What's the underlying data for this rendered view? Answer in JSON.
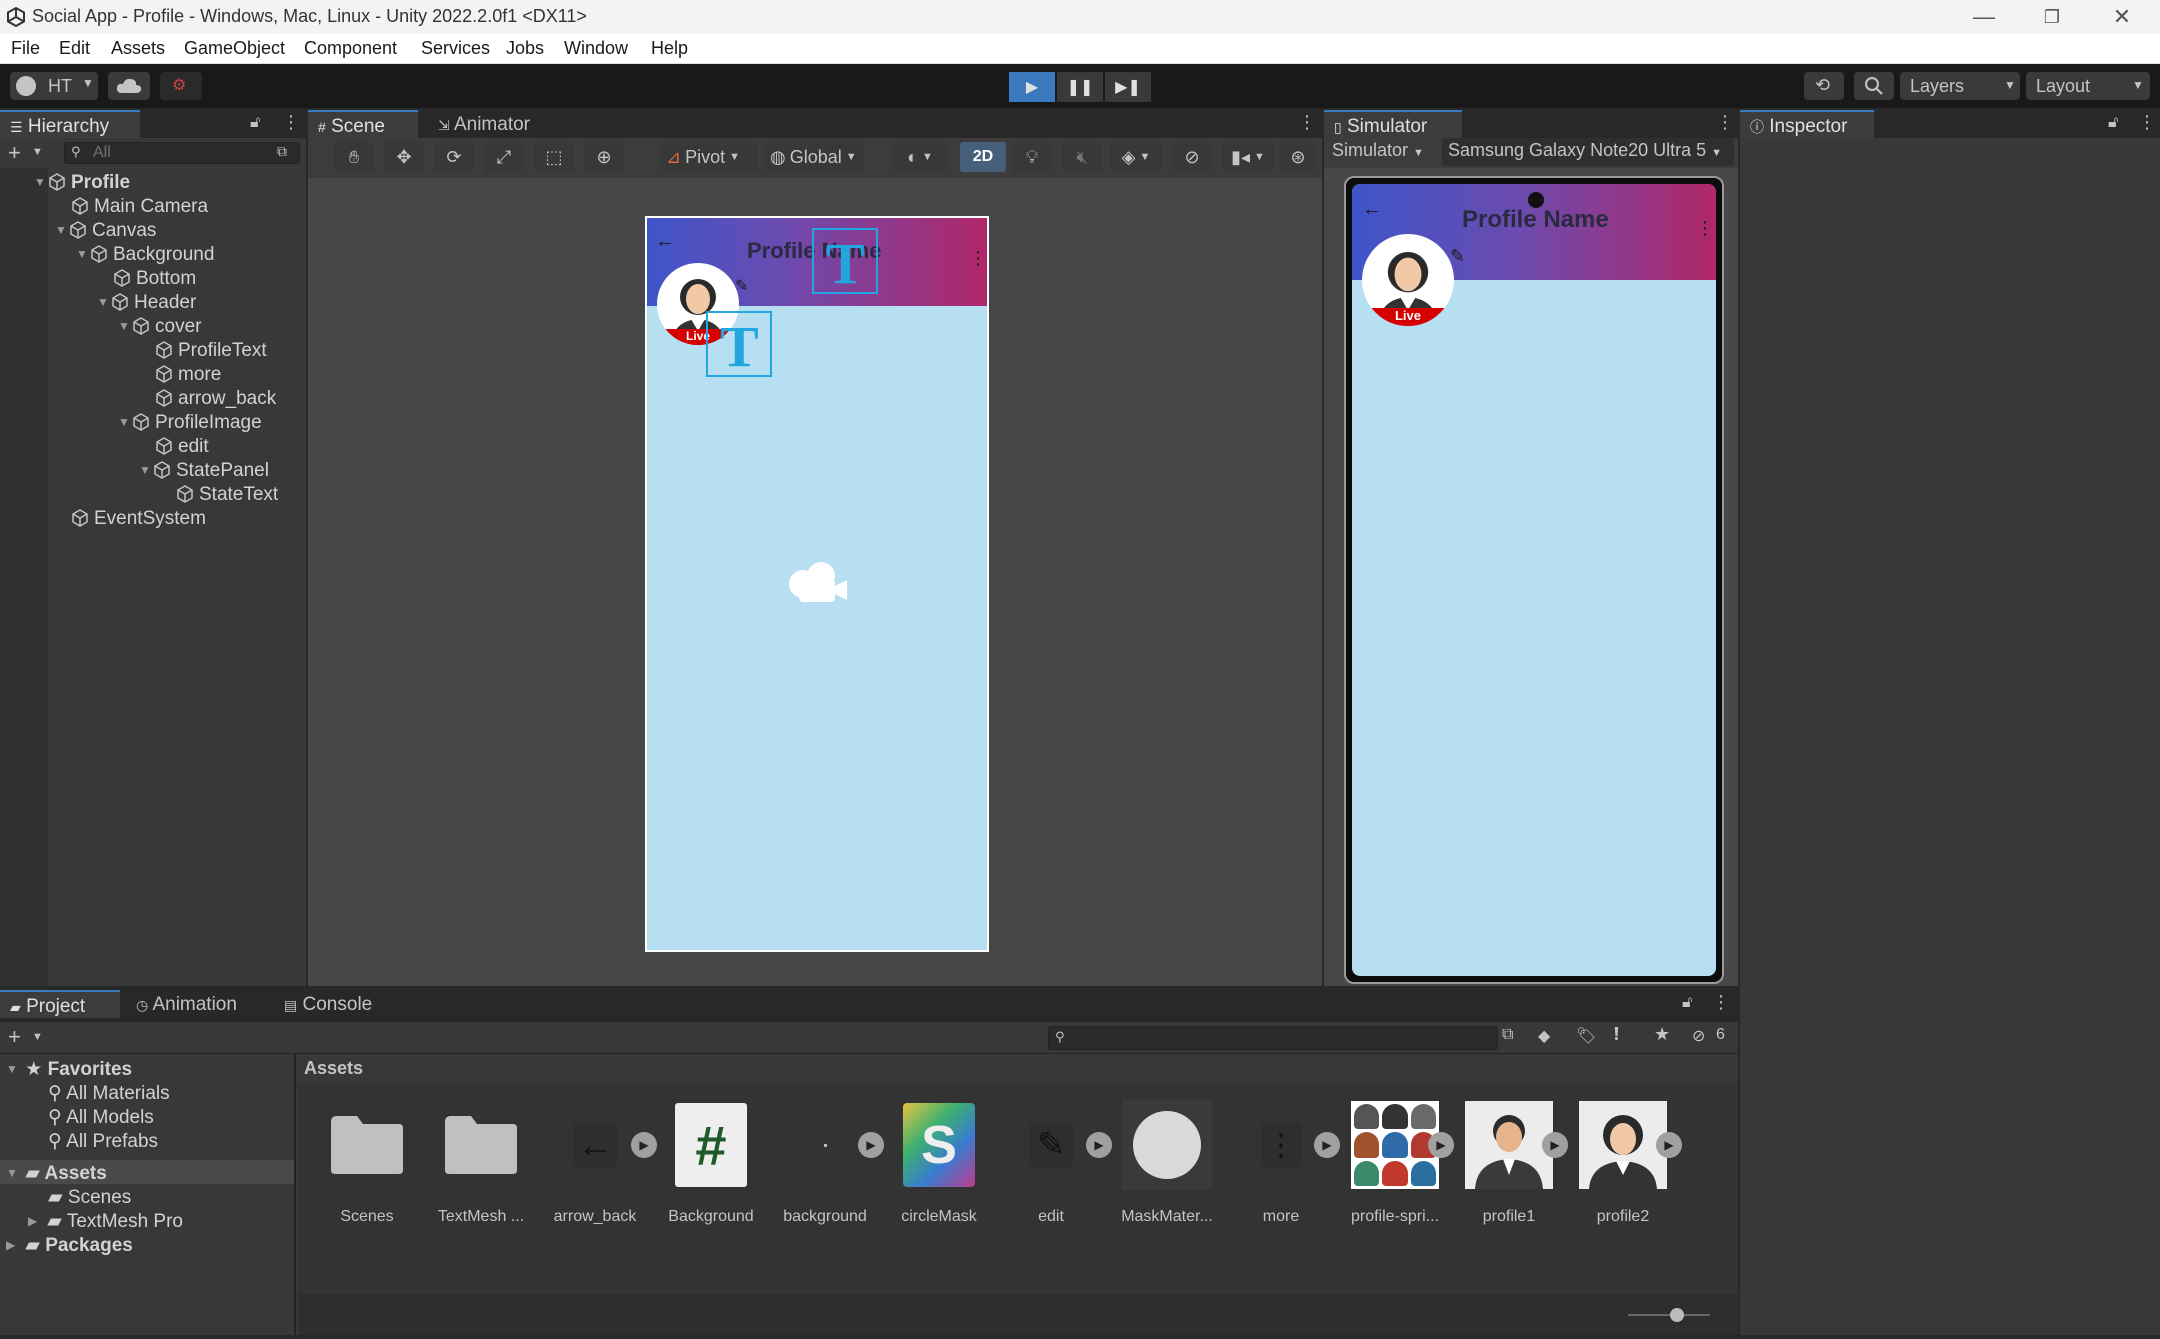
{
  "window": {
    "title": "Social App - Profile - Windows, Mac, Linux - Unity 2022.2.0f1 <DX11>",
    "controls": [
      "—",
      "❐",
      "✕"
    ]
  },
  "menu": [
    "File",
    "Edit",
    "Assets",
    "GameObject",
    "Component",
    "Services",
    "Jobs",
    "Window",
    "Help"
  ],
  "toolbar": {
    "account": "HT",
    "layers_label": "Layers",
    "layout_label": "Layout"
  },
  "hierarchy": {
    "tab": "Hierarchy",
    "search_placeholder": "All",
    "items": [
      {
        "label": "Profile",
        "depth": 0,
        "expanded": true,
        "bold": true
      },
      {
        "label": "Main Camera",
        "depth": 1
      },
      {
        "label": "Canvas",
        "depth": 1,
        "expanded": true
      },
      {
        "label": "Background",
        "depth": 2,
        "expanded": true
      },
      {
        "label": "Bottom",
        "depth": 3
      },
      {
        "label": "Header",
        "depth": 3,
        "expanded": true
      },
      {
        "label": "cover",
        "depth": 4,
        "expanded": true
      },
      {
        "label": "ProfileText",
        "depth": 5
      },
      {
        "label": "more",
        "depth": 5
      },
      {
        "label": "arrow_back",
        "depth": 5
      },
      {
        "label": "ProfileImage",
        "depth": 4,
        "expanded": true
      },
      {
        "label": "edit",
        "depth": 5
      },
      {
        "label": "StatePanel",
        "depth": 5,
        "expanded": true
      },
      {
        "label": "StateText",
        "depth": 6
      },
      {
        "label": "EventSystem",
        "depth": 1
      }
    ]
  },
  "scene": {
    "tabs": [
      "Scene",
      "Animator"
    ],
    "pivot": "Pivot",
    "global": "Global",
    "mode_2d": "2D",
    "preview": {
      "profile_name": "Profile Name",
      "state": "Live"
    }
  },
  "simulator": {
    "tab": "Simulator",
    "mode": "Simulator",
    "device": "Samsung Galaxy Note20 Ultra 5",
    "profile_name": "Profile Name",
    "state": "Live"
  },
  "inspector": {
    "tab": "Inspector"
  },
  "project": {
    "tabs": [
      "Project",
      "Animation",
      "Console"
    ],
    "hidden_count": "6",
    "breadcrumb": "Assets",
    "favorites": {
      "label": "Favorites",
      "items": [
        "All Materials",
        "All Models",
        "All Prefabs"
      ]
    },
    "assets_root": "Assets",
    "assets_children": [
      "Scenes",
      "TextMesh Pro"
    ],
    "packages": "Packages",
    "assets": [
      {
        "label": "Scenes",
        "kind": "folder"
      },
      {
        "label": "TextMesh ...",
        "kind": "folder"
      },
      {
        "label": "arrow_back",
        "kind": "arrow-icon"
      },
      {
        "label": "Background",
        "kind": "script-icon"
      },
      {
        "label": "background",
        "kind": "dot"
      },
      {
        "label": "circleMask",
        "kind": "shader-icon"
      },
      {
        "label": "edit",
        "kind": "pencil-icon"
      },
      {
        "label": "MaskMater...",
        "kind": "material-sphere"
      },
      {
        "label": "more",
        "kind": "more-icon"
      },
      {
        "label": "profile-spri...",
        "kind": "sprite-sheet"
      },
      {
        "label": "profile1",
        "kind": "avatar-male"
      },
      {
        "label": "profile2",
        "kind": "avatar-female"
      }
    ]
  },
  "colors": {
    "accent": "#3a79bb",
    "editor_bg": "#282828",
    "panel_bg": "#383838",
    "phone_bg": "#b6dff2",
    "header_grad_start": "#3e55c9",
    "header_grad_end": "#b12768",
    "live_red": "#d60000"
  }
}
